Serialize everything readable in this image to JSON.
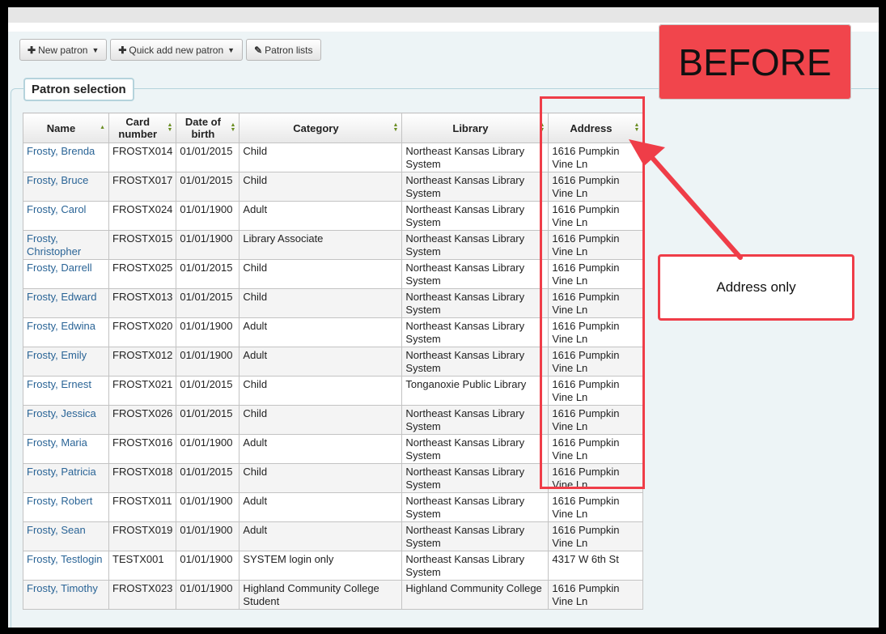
{
  "toolbar": {
    "new_patron": "New patron",
    "quick_add": "Quick add new patron",
    "patron_lists": "Patron lists"
  },
  "section_title": "Patron selection",
  "columns": [
    "Name",
    "Card number",
    "Date of birth",
    "Category",
    "Library",
    "Address"
  ],
  "rows": [
    {
      "name": "Frosty, Brenda",
      "card": "FROSTX014",
      "dob": "01/01/2015",
      "category": "Child",
      "library": "Northeast Kansas Library System",
      "address": "1616 Pumpkin Vine Ln"
    },
    {
      "name": "Frosty, Bruce",
      "card": "FROSTX017",
      "dob": "01/01/2015",
      "category": "Child",
      "library": "Northeast Kansas Library System",
      "address": "1616 Pumpkin Vine Ln"
    },
    {
      "name": "Frosty, Carol",
      "card": "FROSTX024",
      "dob": "01/01/1900",
      "category": "Adult",
      "library": "Northeast Kansas Library System",
      "address": "1616 Pumpkin Vine Ln"
    },
    {
      "name": "Frosty, Christopher",
      "card": "FROSTX015",
      "dob": "01/01/1900",
      "category": "Library Associate",
      "library": "Northeast Kansas Library System",
      "address": "1616 Pumpkin Vine Ln"
    },
    {
      "name": "Frosty, Darrell",
      "card": "FROSTX025",
      "dob": "01/01/2015",
      "category": "Child",
      "library": "Northeast Kansas Library System",
      "address": "1616 Pumpkin Vine Ln"
    },
    {
      "name": "Frosty, Edward",
      "card": "FROSTX013",
      "dob": "01/01/2015",
      "category": "Child",
      "library": "Northeast Kansas Library System",
      "address": "1616 Pumpkin Vine Ln"
    },
    {
      "name": "Frosty, Edwina",
      "card": "FROSTX020",
      "dob": "01/01/1900",
      "category": "Adult",
      "library": "Northeast Kansas Library System",
      "address": "1616 Pumpkin Vine Ln"
    },
    {
      "name": "Frosty, Emily",
      "card": "FROSTX012",
      "dob": "01/01/1900",
      "category": "Adult",
      "library": "Northeast Kansas Library System",
      "address": "1616 Pumpkin Vine Ln"
    },
    {
      "name": "Frosty, Ernest",
      "card": "FROSTX021",
      "dob": "01/01/2015",
      "category": "Child",
      "library": "Tonganoxie Public Library",
      "address": "1616 Pumpkin Vine Ln"
    },
    {
      "name": "Frosty, Jessica",
      "card": "FROSTX026",
      "dob": "01/01/2015",
      "category": "Child",
      "library": "Northeast Kansas Library System",
      "address": "1616 Pumpkin Vine Ln"
    },
    {
      "name": "Frosty, Maria",
      "card": "FROSTX016",
      "dob": "01/01/1900",
      "category": "Adult",
      "library": "Northeast Kansas Library System",
      "address": "1616 Pumpkin Vine Ln"
    },
    {
      "name": "Frosty, Patricia",
      "card": "FROSTX018",
      "dob": "01/01/2015",
      "category": "Child",
      "library": "Northeast Kansas Library System",
      "address": "1616 Pumpkin Vine Ln"
    },
    {
      "name": "Frosty, Robert",
      "card": "FROSTX011",
      "dob": "01/01/1900",
      "category": "Adult",
      "library": "Northeast Kansas Library System",
      "address": "1616 Pumpkin Vine Ln"
    },
    {
      "name": "Frosty, Sean",
      "card": "FROSTX019",
      "dob": "01/01/1900",
      "category": "Adult",
      "library": "Northeast Kansas Library System",
      "address": "1616 Pumpkin Vine Ln"
    },
    {
      "name": "Frosty, Testlogin",
      "card": "TESTX001",
      "dob": "01/01/1900",
      "category": "SYSTEM login only",
      "library": "Northeast Kansas Library System",
      "address": "4317 W 6th St"
    },
    {
      "name": "Frosty, Timothy",
      "card": "FROSTX023",
      "dob": "01/01/1900",
      "category": "Highland Community College Student",
      "library": "Highland Community College",
      "address": "1616 Pumpkin Vine Ln"
    }
  ],
  "annotations": {
    "badge": "BEFORE",
    "callout": "Address only",
    "color": "#ef3d48"
  },
  "icons": {
    "plus": "plus-icon",
    "edit": "edit-icon",
    "sort": "sort-icon"
  }
}
